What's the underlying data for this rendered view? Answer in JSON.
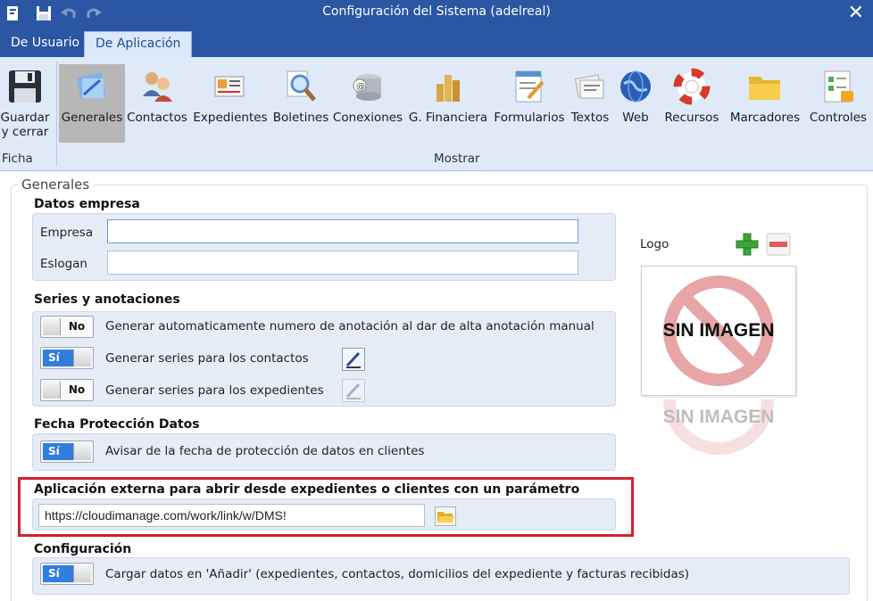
{
  "window": {
    "title": "Configuración del Sistema (adelreal)",
    "close_icon": "close-icon"
  },
  "tabs": [
    {
      "label": "De Usuario",
      "active": false
    },
    {
      "label": "De Aplicación",
      "active": true
    }
  ],
  "ribbon": {
    "groups": {
      "ficha": "Ficha",
      "mostrar": "Mostrar"
    },
    "buttons": {
      "guardar": {
        "line1": "Guardar",
        "line2": "y cerrar",
        "icon": "save-icon"
      },
      "generales": {
        "label": "Generales",
        "icon": "settings-general-icon"
      },
      "contactos": {
        "label": "Contactos",
        "icon": "contacts-icon"
      },
      "expedientes": {
        "label": "Expedientes",
        "icon": "cards-icon"
      },
      "boletines": {
        "label": "Boletines",
        "icon": "magnifier-icon"
      },
      "conexiones": {
        "label": "Conexiones",
        "icon": "database-icon"
      },
      "financiera": {
        "label": "G. Financiera",
        "icon": "coins-icon"
      },
      "formularios": {
        "label": "Formularios",
        "icon": "form-icon"
      },
      "textos": {
        "label": "Textos",
        "icon": "text-icon"
      },
      "web": {
        "label": "Web",
        "icon": "globe-icon"
      },
      "recursos": {
        "label": "Recursos",
        "icon": "lifebuoy-icon"
      },
      "marcadores": {
        "label": "Marcadores",
        "icon": "folder-icon"
      },
      "controles": {
        "label": "Controles",
        "icon": "controls-icon"
      }
    }
  },
  "generales": {
    "legend": "Generales",
    "datos_empresa": {
      "title": "Datos empresa",
      "empresa_label": "Empresa",
      "empresa_value": "",
      "eslogan_label": "Eslogan",
      "eslogan_value": ""
    },
    "series": {
      "title": "Series y anotaciones",
      "rows": [
        {
          "state": "No",
          "text": "Generar automaticamente numero de anotación al dar de alta anotación manual"
        },
        {
          "state": "Sí",
          "text": "Generar series para los contactos"
        },
        {
          "state": "No",
          "text": "Generar series para los expedientes"
        }
      ]
    },
    "proteccion": {
      "title": "Fecha Protección Datos",
      "state": "Sí",
      "text": "Avisar de la fecha de protección de datos en clientes"
    },
    "aplicacion_externa": {
      "title": "Aplicación externa para abrir desde expedientes o clientes con un parámetro",
      "value": "https://cloudimanage.com/work/link/w/DMS!"
    },
    "configuracion": {
      "title": "Configuración",
      "state": "Sí",
      "text": "Cargar datos en 'Añadir' (expedientes, contactos, domicilios del expediente y facturas recibidas)"
    },
    "logo": {
      "label": "Logo",
      "placeholder_text": "SIN IMAGEN"
    }
  },
  "colors": {
    "title_bar": "#2a56a3",
    "ribbon": "#dfe9f7",
    "toggle_on": "#2f7ee0",
    "highlight": "#d22030"
  }
}
